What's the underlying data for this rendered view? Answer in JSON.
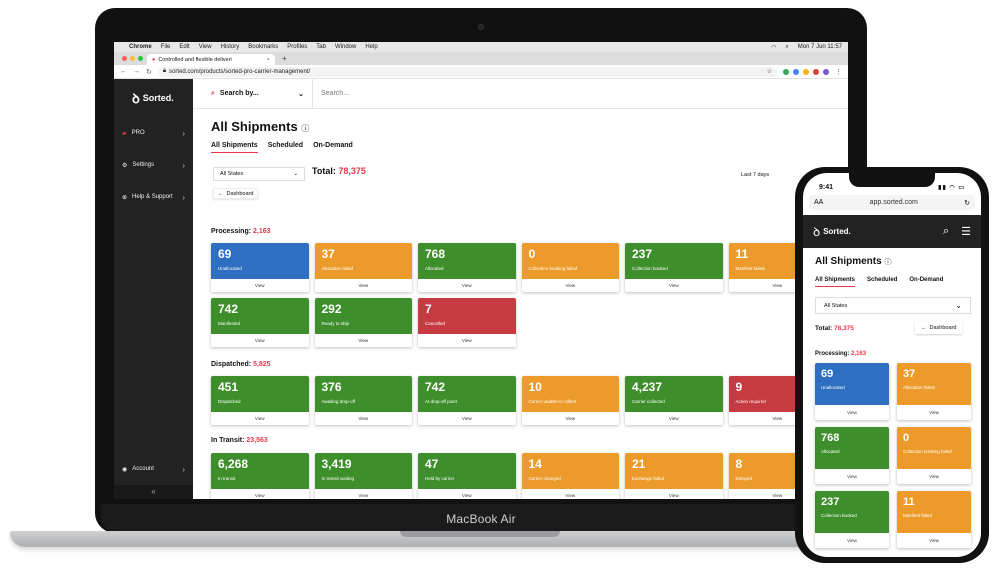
{
  "laptop": {
    "model_label": "MacBook Air",
    "mac_menubar": {
      "app": "Chrome",
      "items": [
        "File",
        "Edit",
        "View",
        "History",
        "Bookmarks",
        "Profiles",
        "Tab",
        "Window",
        "Help"
      ],
      "clock": "Mon 7 Jun  11:57"
    },
    "browser": {
      "tab_title": "Controlled and flexible deliveri",
      "url": "sorted.com/products/sorted-pro-carrier-management/"
    },
    "sidebar": {
      "brand": "Sorted.",
      "items": [
        {
          "label": "PRO",
          "icon": "truck-icon"
        },
        {
          "label": "Settings",
          "icon": "gear-icon"
        },
        {
          "label": "Help & Support",
          "icon": "globe-icon"
        }
      ],
      "account_label": "Account",
      "collapse_glyph": "«"
    },
    "search": {
      "by_label": "Search by...",
      "placeholder": "Search..."
    },
    "page": {
      "title": "All Shipments",
      "tabs": [
        "All Shipments",
        "Scheduled",
        "On-Demand"
      ],
      "state_filter": "All States",
      "total_label": "Total:",
      "total_value": "78,375",
      "date_range": "Last 7 days",
      "dashboard_button": "Dashboard"
    },
    "sections": [
      {
        "label": "Processing:",
        "count": "2,163",
        "cards": [
          {
            "value": "69",
            "label": "Unallocated",
            "color": "blue"
          },
          {
            "value": "37",
            "label": "Allocation failed",
            "color": "orange"
          },
          {
            "value": "768",
            "label": "Allocated",
            "color": "green"
          },
          {
            "value": "0",
            "label": "Collection booking failed",
            "color": "orange"
          },
          {
            "value": "237",
            "label": "Collection booked",
            "color": "green"
          },
          {
            "value": "11",
            "label": "Manifest failed",
            "color": "orange"
          },
          {
            "value": "742",
            "label": "Manifested",
            "color": "green"
          },
          {
            "value": "292",
            "label": "Ready to ship",
            "color": "green"
          },
          {
            "value": "7",
            "label": "Cancelled",
            "color": "red"
          }
        ]
      },
      {
        "label": "Dispatched:",
        "count": "5,825",
        "cards": [
          {
            "value": "451",
            "label": "Dispatched",
            "color": "green"
          },
          {
            "value": "376",
            "label": "Awaiting drop-off",
            "color": "green"
          },
          {
            "value": "742",
            "label": "At drop-off point",
            "color": "green"
          },
          {
            "value": "10",
            "label": "Carrier unable to collect",
            "color": "orange"
          },
          {
            "value": "4,237",
            "label": "Carrier collected",
            "color": "green"
          },
          {
            "value": "9",
            "label": "Action required",
            "color": "red"
          }
        ]
      },
      {
        "label": "In Transit:",
        "count": "23,563",
        "cards": [
          {
            "value": "6,268",
            "label": "In transit",
            "color": "green"
          },
          {
            "value": "3,419",
            "label": "In transit waiting",
            "color": "green"
          },
          {
            "value": "47",
            "label": "Held by carrier",
            "color": "green"
          },
          {
            "value": "14",
            "label": "Carrier changed",
            "color": "orange"
          },
          {
            "value": "21",
            "label": "Exchange failed",
            "color": "orange"
          },
          {
            "value": "8",
            "label": "Delayed",
            "color": "orange"
          }
        ]
      }
    ],
    "view_label": "View"
  },
  "phone": {
    "time": "9:41",
    "aa_label": "AA",
    "url": "app.sorted.com",
    "brand": "Sorted.",
    "title": "All Shipments",
    "tabs": [
      "All Shipments",
      "Scheduled",
      "On-Demand"
    ],
    "state_filter": "All States",
    "total_label": "Total:",
    "total_value": "78,375",
    "dashboard_button": "Dashboard",
    "section_label": "Processing:",
    "section_count": "2,163",
    "cards": [
      {
        "value": "69",
        "label": "Unallocated",
        "color": "blue"
      },
      {
        "value": "37",
        "label": "Allocation failed",
        "color": "orange"
      },
      {
        "value": "768",
        "label": "Allocated",
        "color": "green"
      },
      {
        "value": "0",
        "label": "Collection booking failed",
        "color": "orange"
      },
      {
        "value": "237",
        "label": "Collection booked",
        "color": "green"
      },
      {
        "value": "11",
        "label": "Manifest failed",
        "color": "orange"
      }
    ],
    "view_label": "View"
  },
  "colors": {
    "accent": "#e8364a",
    "blue": "#2f6fc2",
    "orange": "#ec9b2a",
    "green": "#3e8f2b",
    "red": "#c63a41"
  }
}
